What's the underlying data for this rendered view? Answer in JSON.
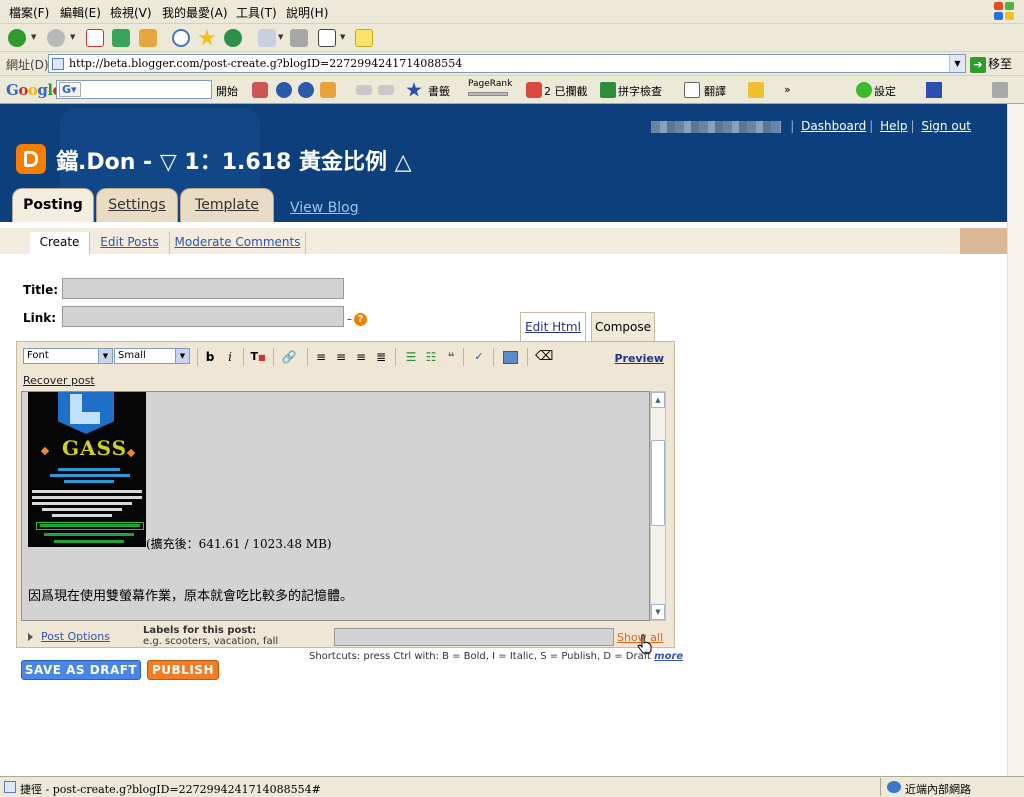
{
  "menubar": {
    "items": [
      "檔案(F)",
      "編輯(E)",
      "檢視(V)",
      "我的最愛(A)",
      "工具(T)",
      "說明(H)"
    ]
  },
  "address": {
    "label": "網址(D)",
    "url": "http://beta.blogger.com/post-create.g?blogID=2272994241714088554",
    "go_label": "移至"
  },
  "google_toolbar": {
    "logo": "Google",
    "search_label": "開始",
    "bookmarks": "書籤",
    "pagerank": "PageRank",
    "blocked": "2 已攔截",
    "spell": "拼字檢查",
    "translate": "翻譯",
    "settings": "設定"
  },
  "header": {
    "blog_title": "鐺.Don - ▽ 1：1.618 黃金比例 △",
    "links": {
      "dashboard": "Dashboard",
      "help": "Help",
      "signout": "Sign out"
    }
  },
  "main_tabs": [
    {
      "label": "Posting",
      "active": true
    },
    {
      "label": "Settings",
      "active": false
    },
    {
      "label": "Template",
      "active": false
    }
  ],
  "view_blog": "View Blog",
  "sub_tabs": [
    {
      "label": "Create",
      "active": true
    },
    {
      "label": "Edit Posts",
      "active": false
    },
    {
      "label": "Moderate Comments",
      "active": false
    }
  ],
  "form": {
    "title_label": "Title:",
    "link_label": "Link:",
    "help_icon": "?"
  },
  "mode_tabs": {
    "edit_html": "Edit Html",
    "compose": "Compose"
  },
  "editor": {
    "font_select": "Font",
    "size_select": "Small",
    "bold": "b",
    "italic": "i",
    "preview": "Preview",
    "recover": "Recover post"
  },
  "content": {
    "image_caption_line1": "GASS",
    "caption": "(擴充後：641.61 / 1023.48 MB)",
    "body": "因爲現在使用雙螢幕作業，原本就會吃比較多的記憶體。"
  },
  "labels_row": {
    "post_options": "Post Options",
    "labels_title": "Labels for this post:",
    "labels_hint": "e.g. scooters, vacation, fall",
    "show_all": "Show all"
  },
  "shortcuts": {
    "text": "Shortcuts: press Ctrl with: B = Bold, I = Italic, S = Publish, D = Draft",
    "more": "more"
  },
  "buttons": {
    "save_draft": "SAVE AS DRAFT",
    "publish": "PUBLISH"
  },
  "status": {
    "text": "捷徑 - post-create.g?blogID=2272994241714088554#",
    "zone": "近端內部網路"
  }
}
